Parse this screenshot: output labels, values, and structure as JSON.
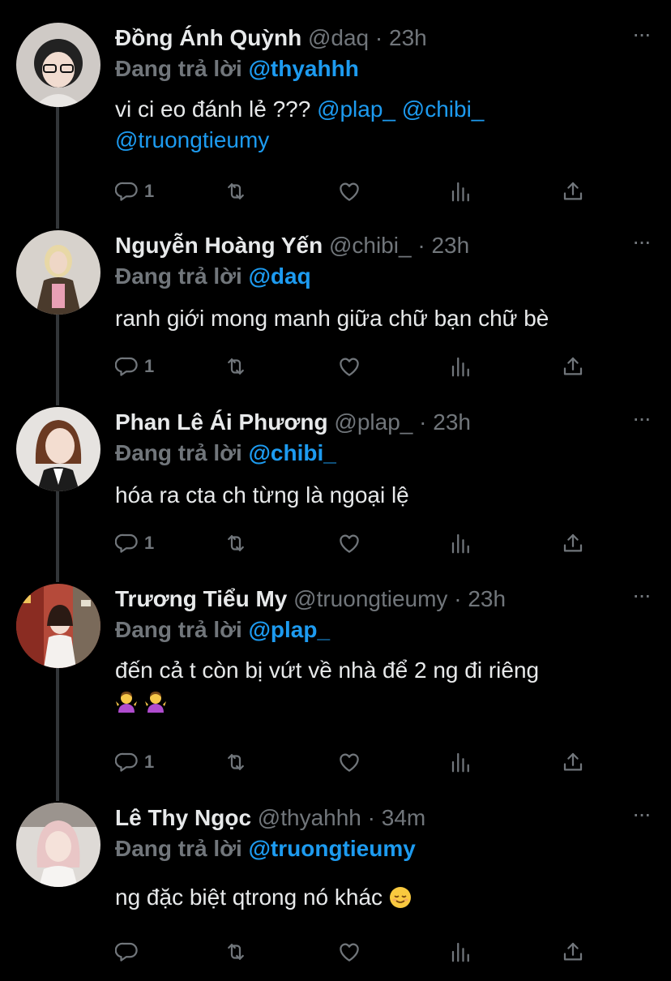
{
  "accent_color": "#1d9bf0",
  "reply_prefix": "Đang trả lời",
  "tweets": [
    {
      "name": "Đồng Ánh Quỳnh",
      "handle": "@daq",
      "time": "23h",
      "reply_to": "@thyahhh",
      "text_line1": "vi ci eo đánh lẻ ??? ",
      "mentions_line1": [
        "@plap_",
        "@chibi_"
      ],
      "mentions_line2": [
        "@truongtieumy"
      ],
      "reply_count": "1"
    },
    {
      "name": "Nguyễn Hoàng Yến",
      "handle": "@chibi_",
      "time": "23h",
      "reply_to": "@daq",
      "text_line1": "ranh giới mong manh giữa chữ bạn chữ bè",
      "reply_count": "1"
    },
    {
      "name": "Phan Lê Ái Phương",
      "handle": "@plap_",
      "time": "23h",
      "reply_to": "@chibi_",
      "text_line1": "hóa ra cta ch từng là ngoại lệ",
      "reply_count": "1"
    },
    {
      "name": "Trương Tiểu My",
      "handle": "@truongtieumy",
      "time": "23h",
      "reply_to": "@plap_",
      "text_line1": "đến cả t còn bị vứt về nhà để 2 ng đi riêng",
      "emoji_line2": [
        "person-shrugging-emoji",
        "person-shrugging-emoji"
      ],
      "reply_count": "1"
    },
    {
      "name": "Lê Thy Ngọc",
      "handle": "@thyahhh",
      "time": "34m",
      "reply_to": "@truongtieumy",
      "text_line1": "ng đặc biệt qtrong nó khác ",
      "emoji_line1": "relieved-face-emoji",
      "reply_count": ""
    }
  ],
  "icons": {
    "reply": "reply-icon",
    "retweet": "retweet-icon",
    "like": "like-icon",
    "views": "views-icon",
    "share": "share-icon",
    "more": "more-icon"
  }
}
